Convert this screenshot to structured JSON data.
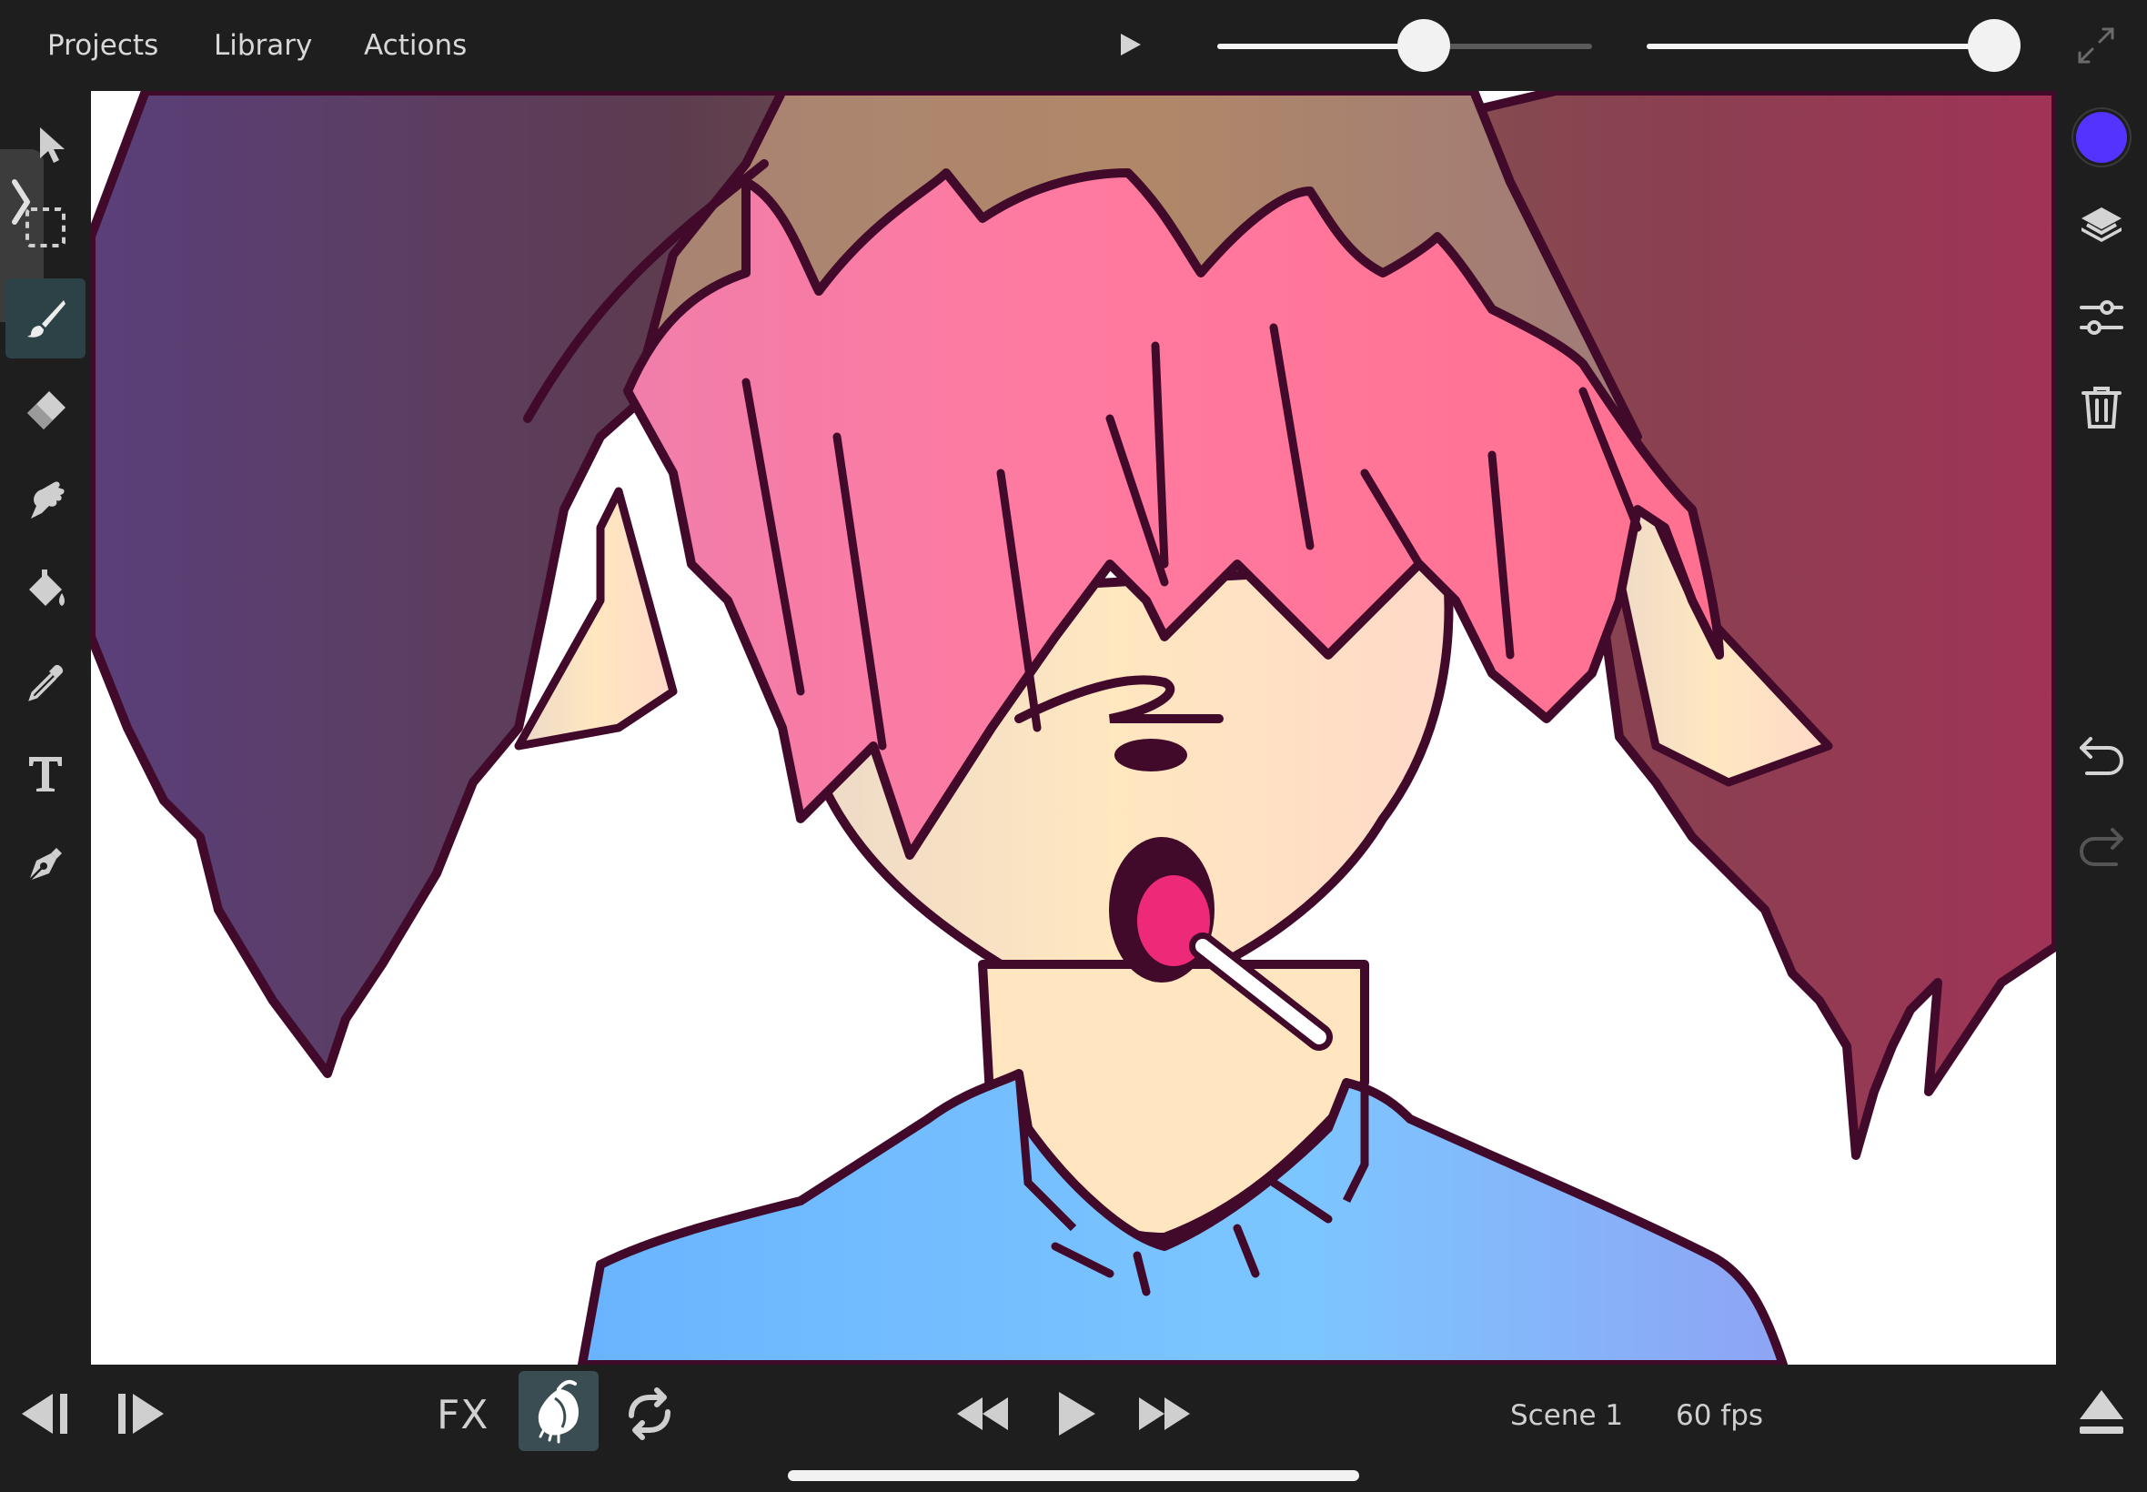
{
  "menu": {
    "projects": "Projects",
    "library": "Library",
    "actions": "Actions"
  },
  "top_controls": {
    "play_icon": "play-icon",
    "slider_1_level_percent": 55,
    "slider_2_level_percent": 100,
    "fullscreen_icon": "expand-icon"
  },
  "left_tools": [
    {
      "name": "select",
      "icon": "pointer-arrow-icon"
    },
    {
      "name": "marquee",
      "icon": "dashed-selection-icon"
    },
    {
      "name": "brush",
      "icon": "brush-icon",
      "active": true
    },
    {
      "name": "eraser",
      "icon": "eraser-icon"
    },
    {
      "name": "smudge",
      "icon": "smudge-hand-icon"
    },
    {
      "name": "fill",
      "icon": "paint-bucket-icon"
    },
    {
      "name": "eyedropper",
      "icon": "eyedropper-icon"
    },
    {
      "name": "text",
      "icon": "text-tool-icon",
      "glyph": "T"
    },
    {
      "name": "pen",
      "icon": "pen-nib-icon"
    }
  ],
  "right_tools": {
    "current_color": "#5533ff",
    "icons": [
      "layers-icon",
      "adjustments-icon",
      "trash-icon",
      "undo-icon",
      "redo-icon"
    ]
  },
  "bottom": {
    "fx_label": "FX",
    "onion_skin_active": true,
    "scene": "Scene 1",
    "fps": "60 fps",
    "icons": [
      "previous-frame-icon",
      "next-frame-icon",
      "onion-skin-icon",
      "loop-icon",
      "rewind-icon",
      "play-icon",
      "fast-forward-icon",
      "eject-icon"
    ]
  },
  "colors": {
    "toolbar_bg": "#1e1e1e",
    "active_tool_bg": "#2c4246",
    "canvas_bg": "#ffffff"
  }
}
